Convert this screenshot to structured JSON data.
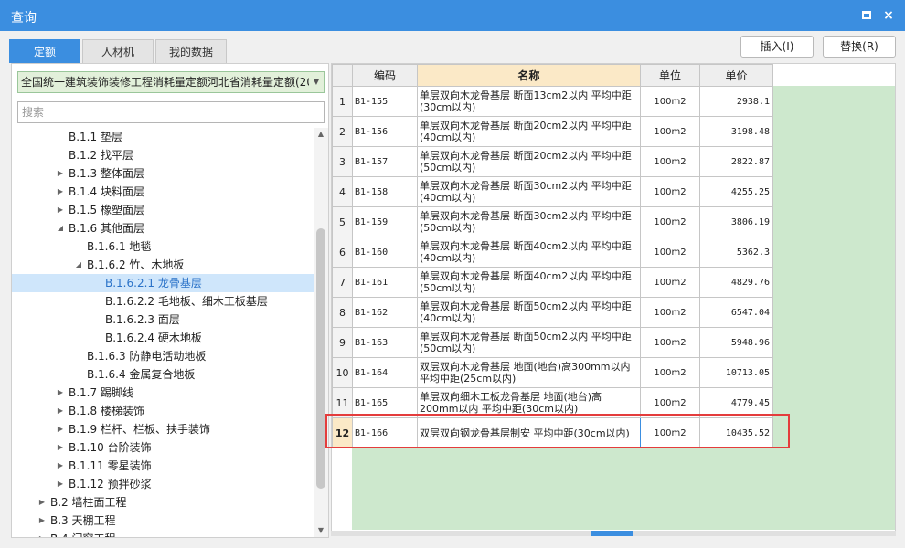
{
  "window": {
    "title": "查询",
    "maximize_label": "",
    "close_label": "×"
  },
  "tabs": [
    {
      "label": "定额",
      "active": true
    },
    {
      "label": "人材机",
      "active": false
    },
    {
      "label": "我的数据",
      "active": false
    }
  ],
  "toolbar": {
    "insert_label": "插入(I)",
    "replace_label": "替换(R)"
  },
  "library_select": {
    "value": "全国统一建筑装饰装修工程消耗量定额河北省消耗量定额(20"
  },
  "search": {
    "placeholder": "搜索"
  },
  "tree": [
    {
      "label": "B.1.1 垫层",
      "level": 3,
      "expander": "none"
    },
    {
      "label": "B.1.2 找平层",
      "level": 3,
      "expander": "none"
    },
    {
      "label": "B.1.3 整体面层",
      "level": 3,
      "expander": "collapsed"
    },
    {
      "label": "B.1.4 块料面层",
      "level": 3,
      "expander": "collapsed"
    },
    {
      "label": "B.1.5 橡塑面层",
      "level": 3,
      "expander": "collapsed"
    },
    {
      "label": "B.1.6 其他面层",
      "level": 3,
      "expander": "expanded"
    },
    {
      "label": "B.1.6.1 地毯",
      "level": 4,
      "expander": "none"
    },
    {
      "label": "B.1.6.2 竹、木地板",
      "level": 4,
      "expander": "expanded"
    },
    {
      "label": "B.1.6.2.1 龙骨基层",
      "level": 5,
      "expander": "none",
      "selected": true
    },
    {
      "label": "B.1.6.2.2 毛地板、细木工板基层",
      "level": 5,
      "expander": "none"
    },
    {
      "label": "B.1.6.2.3 面层",
      "level": 5,
      "expander": "none"
    },
    {
      "label": "B.1.6.2.4 硬木地板",
      "level": 5,
      "expander": "none"
    },
    {
      "label": "B.1.6.3 防静电活动地板",
      "level": 4,
      "expander": "none"
    },
    {
      "label": "B.1.6.4 金属复合地板",
      "level": 4,
      "expander": "none"
    },
    {
      "label": "B.1.7 踢脚线",
      "level": 3,
      "expander": "collapsed"
    },
    {
      "label": "B.1.8 楼梯装饰",
      "level": 3,
      "expander": "collapsed"
    },
    {
      "label": "B.1.9 栏杆、栏板、扶手装饰",
      "level": 3,
      "expander": "collapsed"
    },
    {
      "label": "B.1.10 台阶装饰",
      "level": 3,
      "expander": "collapsed"
    },
    {
      "label": "B.1.11 零星装饰",
      "level": 3,
      "expander": "collapsed"
    },
    {
      "label": "B.1.12 预拌砂浆",
      "level": 3,
      "expander": "collapsed"
    },
    {
      "label": "B.2 墙柱面工程",
      "level": 2,
      "expander": "collapsed"
    },
    {
      "label": "B.3 天棚工程",
      "level": 2,
      "expander": "collapsed"
    },
    {
      "label": "B.4 门窗工程",
      "level": 2,
      "expander": "collapsed"
    }
  ],
  "table": {
    "columns": [
      "",
      "编码",
      "名称",
      "单位",
      "单价"
    ],
    "rows": [
      {
        "idx": "1",
        "code": "B1-155",
        "name": "单层双向木龙骨基层 断面13cm2以内 平均中距(30cm以内)",
        "unit": "100m2",
        "price": "2938.1"
      },
      {
        "idx": "2",
        "code": "B1-156",
        "name": "单层双向木龙骨基层 断面20cm2以内 平均中距(40cm以内)",
        "unit": "100m2",
        "price": "3198.48"
      },
      {
        "idx": "3",
        "code": "B1-157",
        "name": "单层双向木龙骨基层 断面20cm2以内 平均中距(50cm以内)",
        "unit": "100m2",
        "price": "2822.87"
      },
      {
        "idx": "4",
        "code": "B1-158",
        "name": "单层双向木龙骨基层 断面30cm2以内 平均中距(40cm以内)",
        "unit": "100m2",
        "price": "4255.25"
      },
      {
        "idx": "5",
        "code": "B1-159",
        "name": "单层双向木龙骨基层 断面30cm2以内 平均中距(50cm以内)",
        "unit": "100m2",
        "price": "3806.19"
      },
      {
        "idx": "6",
        "code": "B1-160",
        "name": "单层双向木龙骨基层 断面40cm2以内 平均中距(40cm以内)",
        "unit": "100m2",
        "price": "5362.3"
      },
      {
        "idx": "7",
        "code": "B1-161",
        "name": "单层双向木龙骨基层 断面40cm2以内 平均中距(50cm以内)",
        "unit": "100m2",
        "price": "4829.76"
      },
      {
        "idx": "8",
        "code": "B1-162",
        "name": "单层双向木龙骨基层 断面50cm2以内 平均中距(40cm以内)",
        "unit": "100m2",
        "price": "6547.04"
      },
      {
        "idx": "9",
        "code": "B1-163",
        "name": "单层双向木龙骨基层 断面50cm2以内 平均中距(50cm以内)",
        "unit": "100m2",
        "price": "5948.96"
      },
      {
        "idx": "10",
        "code": "B1-164",
        "name": "双层双向木龙骨基层 地面(地台)高300mm以内 平均中距(25cm以内)",
        "unit": "100m2",
        "price": "10713.05"
      },
      {
        "idx": "11",
        "code": "B1-165",
        "name": "单层双向细木工板龙骨基层 地面(地台)高200mm以内 平均中距(30cm以内)",
        "unit": "100m2",
        "price": "4779.45"
      },
      {
        "idx": "12",
        "code": "B1-166",
        "name": "双层双向钢龙骨基层制安 平均中距(30cm以内)",
        "unit": "100m2",
        "price": "10435.52",
        "selected": true
      }
    ]
  },
  "colors": {
    "accent": "#3b8ee0",
    "highlight_box": "#e43c3c",
    "grid_empty": "#cde8cd",
    "selector_bg": "#e2f0da"
  }
}
